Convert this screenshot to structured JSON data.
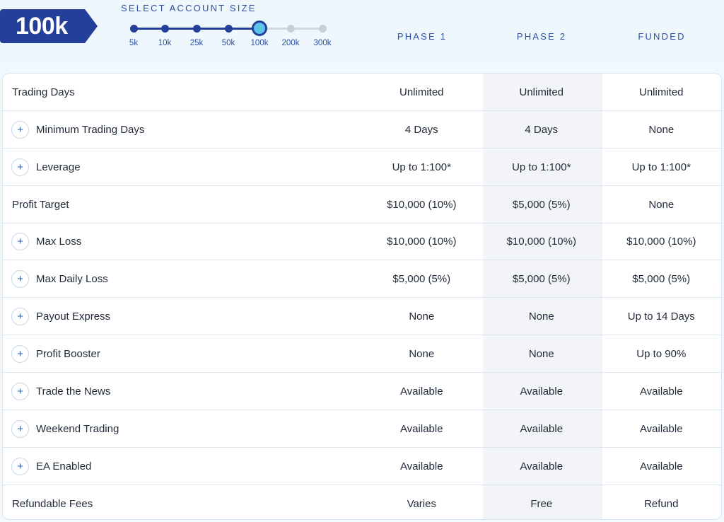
{
  "header": {
    "selected_size": "100k",
    "select_label": "SELECT ACCOUNT SIZE",
    "sizes": [
      "5k",
      "10k",
      "25k",
      "50k",
      "100k",
      "200k",
      "300k"
    ],
    "selected_index": 4,
    "columns": [
      "PHASE 1",
      "PHASE 2",
      "FUNDED"
    ]
  },
  "rows": [
    {
      "label": "Trading Days",
      "expandable": false,
      "values": [
        "Unlimited",
        "Unlimited",
        "Unlimited"
      ]
    },
    {
      "label": "Minimum Trading Days",
      "expandable": true,
      "values": [
        "4 Days",
        "4 Days",
        "None"
      ]
    },
    {
      "label": "Leverage",
      "expandable": true,
      "values": [
        "Up to 1:100*",
        "Up to 1:100*",
        "Up to 1:100*"
      ]
    },
    {
      "label": "Profit Target",
      "expandable": false,
      "values": [
        "$10,000 (10%)",
        "$5,000 (5%)",
        "None"
      ]
    },
    {
      "label": "Max Loss",
      "expandable": true,
      "values": [
        "$10,000 (10%)",
        "$10,000 (10%)",
        "$10,000 (10%)"
      ]
    },
    {
      "label": "Max Daily Loss",
      "expandable": true,
      "values": [
        "$5,000 (5%)",
        "$5,000 (5%)",
        "$5,000 (5%)"
      ]
    },
    {
      "label": "Payout Express",
      "expandable": true,
      "values": [
        "None",
        "None",
        "Up to 14 Days"
      ]
    },
    {
      "label": "Profit Booster",
      "expandable": true,
      "values": [
        "None",
        "None",
        "Up to 90%"
      ]
    },
    {
      "label": "Trade the News",
      "expandable": true,
      "values": [
        "Available",
        "Available",
        "Available"
      ]
    },
    {
      "label": "Weekend Trading",
      "expandable": true,
      "values": [
        "Available",
        "Available",
        "Available"
      ]
    },
    {
      "label": "EA Enabled",
      "expandable": true,
      "values": [
        "Available",
        "Available",
        "Available"
      ]
    },
    {
      "label": "Refundable Fees",
      "expandable": false,
      "values": [
        "Varies",
        "Free",
        "Refund"
      ]
    }
  ],
  "icons": {
    "expand": "plus-icon"
  },
  "colors": {
    "brand": "#243f99",
    "accent": "#5ec3ea",
    "header_text": "#2d4fa3",
    "shaded_column": "#f3f4f8"
  }
}
